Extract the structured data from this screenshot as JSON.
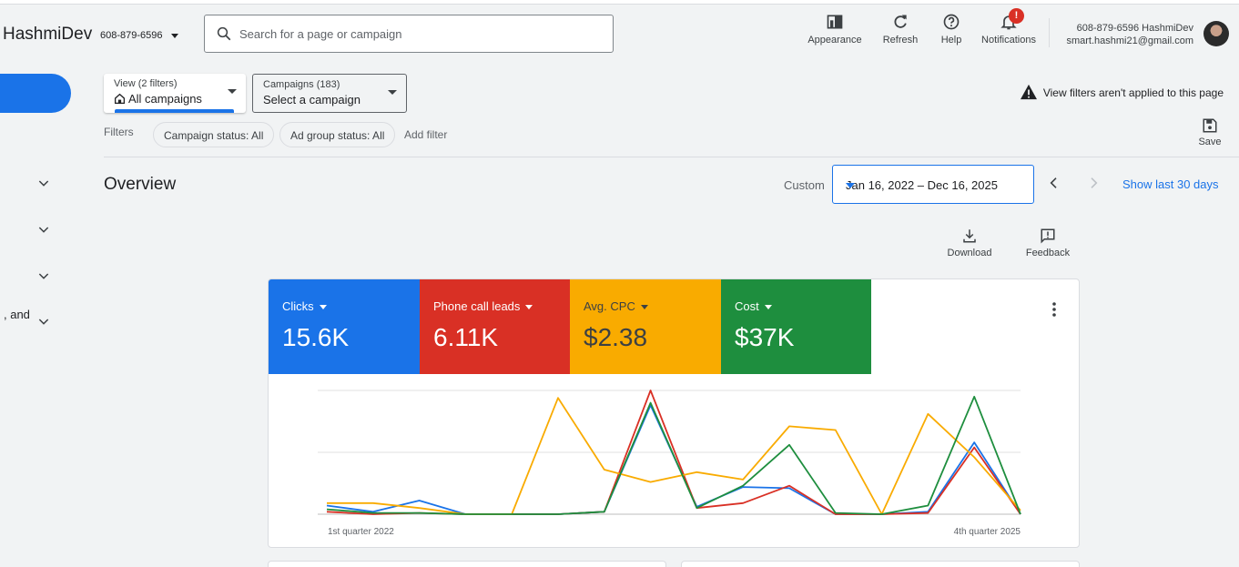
{
  "header": {
    "brand": "HashmiDev",
    "phone": "608-879-6596",
    "search_placeholder": "Search for a page or campaign",
    "tools": {
      "appearance": "Appearance",
      "refresh": "Refresh",
      "help": "Help",
      "notifications": "Notifications",
      "notification_badge": "!"
    },
    "account": {
      "line1": "608-879-6596 HashmiDev",
      "line2": "smart.hashmi21@gmail.com"
    }
  },
  "sidebar": {
    "truncated_label": ", and"
  },
  "view_dropdown": {
    "small": "View (2 filters)",
    "label": "All campaigns"
  },
  "campaigns_dropdown": {
    "small": "Campaigns (183)",
    "label": "Select a campaign"
  },
  "warning": "View filters aren't applied to this page",
  "filters": {
    "label": "Filters",
    "chips": [
      "Campaign status: All",
      "Ad group status: All"
    ],
    "add": "Add filter"
  },
  "save_label": "Save",
  "overview": {
    "title": "Overview",
    "custom_label": "Custom",
    "date_range": "Jan 16, 2022 – Dec 16, 2025",
    "show_last": "Show last 30 days",
    "download": "Download",
    "feedback": "Feedback"
  },
  "metrics": [
    {
      "label": "Clicks",
      "value": "15.6K",
      "color": "#1a73e8"
    },
    {
      "label": "Phone call leads",
      "value": "6.11K",
      "color": "#d93025"
    },
    {
      "label": "Avg. CPC",
      "value": "$2.38",
      "color": "#f9ab00"
    },
    {
      "label": "Cost",
      "value": "$37K",
      "color": "#1e8e3e"
    }
  ],
  "chart_data": {
    "type": "line",
    "x_start_label": "1st quarter 2022",
    "x_end_label": "4th quarter 2025",
    "grid": true,
    "ylim": [
      0,
      1
    ],
    "series": [
      {
        "color": "#1a73e8",
        "values": [
          0.07,
          0.02,
          0.11,
          0.0,
          0.0,
          0.0,
          0.02,
          0.88,
          0.06,
          0.22,
          0.21,
          0.0,
          0.0,
          0.02,
          0.58,
          0.0
        ]
      },
      {
        "color": "#d93025",
        "values": [
          0.02,
          0.0,
          0.01,
          0.0,
          0.0,
          0.0,
          0.02,
          1.0,
          0.05,
          0.09,
          0.23,
          0.0,
          0.0,
          0.01,
          0.54,
          0.0
        ]
      },
      {
        "color": "#f9ab00",
        "values": [
          0.09,
          0.09,
          0.05,
          0.0,
          0.0,
          0.94,
          0.36,
          0.26,
          0.34,
          0.28,
          0.71,
          0.68,
          0.0,
          0.81,
          0.46,
          0.03
        ]
      },
      {
        "color": "#1e8e3e",
        "values": [
          0.04,
          0.01,
          0.01,
          0.0,
          0.0,
          0.0,
          0.02,
          0.9,
          0.05,
          0.23,
          0.56,
          0.01,
          0.0,
          0.07,
          0.95,
          0.0
        ]
      }
    ]
  }
}
